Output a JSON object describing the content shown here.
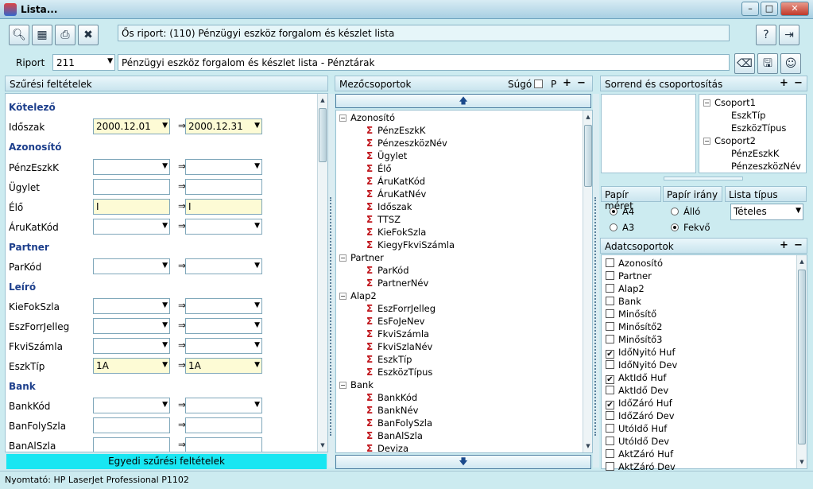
{
  "window": {
    "title": "Lista...",
    "min": "–",
    "max": "□",
    "close": "✕"
  },
  "header": {
    "report_path": "Ős riport: (110)  Pénzügyi eszköz forgalom és készlet lista",
    "riport_label": "Riport",
    "riport_value": "211",
    "riport_name": "Pénzügyi eszköz forgalom és készlet lista - Pénztárak"
  },
  "filters": {
    "title": "Szűrési feltételek",
    "sections": {
      "kotelezo": "Kötelező",
      "azonosito": "Azonosító",
      "partner": "Partner",
      "leiro": "Leíró",
      "bank": "Bank"
    },
    "fields": {
      "idoszak": {
        "label": "Időszak",
        "from": "2000.12.01",
        "to": "2000.12.31"
      },
      "penzeszkk": {
        "label": "PénzEszkK"
      },
      "ugylet": {
        "label": "Ügylet"
      },
      "elo": {
        "label": "Élő",
        "from": "I",
        "to": "I"
      },
      "arukatkod": {
        "label": "ÁruKatKód"
      },
      "parkod": {
        "label": "ParKód"
      },
      "kiefokszla": {
        "label": "KieFokSzla"
      },
      "eszforrjelleg": {
        "label": "EszForrJelleg"
      },
      "fkviszamla": {
        "label": "FkviSzámla"
      },
      "eszktip": {
        "label": "EszkTíp",
        "from": "1A",
        "to": "1A"
      },
      "bankkod": {
        "label": "BankKód"
      },
      "banfolyszla": {
        "label": "BanFolySzla"
      },
      "banalszla": {
        "label": "BanAlSzla"
      }
    },
    "arrow": "⇒",
    "custom_button": "Egyedi szűrési feltételek"
  },
  "fieldgroups": {
    "title": "Mezőcsoportok",
    "sugo": "Súgó",
    "p": "P",
    "plus": "+",
    "minus": "−",
    "up_arrow": "🡅",
    "down_arrow": "🡇",
    "tree": [
      {
        "group": "Azonosító",
        "items": [
          "PénzEszkK",
          "PénzeszközNév",
          "Ügylet",
          "Élő",
          "ÁruKatKód",
          "ÁruKatNév",
          "Időszak",
          "TTSZ",
          "KieFokSzla",
          "KiegyFkviSzámla"
        ]
      },
      {
        "group": "Partner",
        "items": [
          "ParKód",
          "PartnerNév"
        ]
      },
      {
        "group": "Alap2",
        "items": [
          "EszForrJelleg",
          "EsFoJeNev",
          "FkviSzámla",
          "FkviSzlaNév",
          "EszkTíp",
          "EszközTípus"
        ]
      },
      {
        "group": "Bank",
        "items": [
          "BankKód",
          "BankNév",
          "BanFolySzla",
          "BanAlSzla",
          "Deviza"
        ]
      }
    ]
  },
  "sorting": {
    "title": "Sorrend és csoportosítás",
    "groups": [
      {
        "name": "Csoport1",
        "items": [
          "EszkTíp",
          "EszközTípus"
        ]
      },
      {
        "name": "Csoport2",
        "items": [
          "PénzEszkK",
          "PénzeszközNév"
        ]
      }
    ]
  },
  "print_options": {
    "paper_size_label": "Papír méret",
    "orientation_label": "Papír irány",
    "list_type_label": "Lista típus",
    "a4": "A4",
    "a3": "A3",
    "allo": "Álló",
    "fekvo": "Fekvő",
    "selected_size": "A4",
    "selected_orientation": "Fekvő",
    "list_type_value": "Tételes"
  },
  "datagroups": {
    "title": "Adatcsoportok",
    "items": [
      {
        "label": "Azonosító",
        "checked": false
      },
      {
        "label": "Partner",
        "checked": false
      },
      {
        "label": "Alap2",
        "checked": false
      },
      {
        "label": "Bank",
        "checked": false
      },
      {
        "label": "Minősítő",
        "checked": false
      },
      {
        "label": "Minősítő2",
        "checked": false
      },
      {
        "label": "Minősítő3",
        "checked": false
      },
      {
        "label": "IdőNyitó Huf",
        "checked": true
      },
      {
        "label": "IdőNyitó Dev",
        "checked": false
      },
      {
        "label": "AktIdő Huf",
        "checked": true
      },
      {
        "label": "AktIdő Dev",
        "checked": false
      },
      {
        "label": "IdőZáró Huf",
        "checked": true
      },
      {
        "label": "IdőZáró Dev",
        "checked": false
      },
      {
        "label": "UtóIdő Huf",
        "checked": false
      },
      {
        "label": "UtóIdő Dev",
        "checked": false
      },
      {
        "label": "AktZáró Huf",
        "checked": false
      },
      {
        "label": "AktZáró Dev",
        "checked": false
      }
    ],
    "check_mark": "✔"
  },
  "status": {
    "printer": "Nyomtató: HP LaserJet Professional P1102"
  },
  "icons": {
    "app": "app-icon",
    "zoom": "magnifier-icon",
    "calc": "calculator-icon",
    "print": "printer-icon",
    "excel": "excel-icon",
    "help": "help-icon",
    "exit": "exit-icon",
    "eraser": "eraser-icon",
    "save": "save-icon",
    "users": "users-icon"
  }
}
